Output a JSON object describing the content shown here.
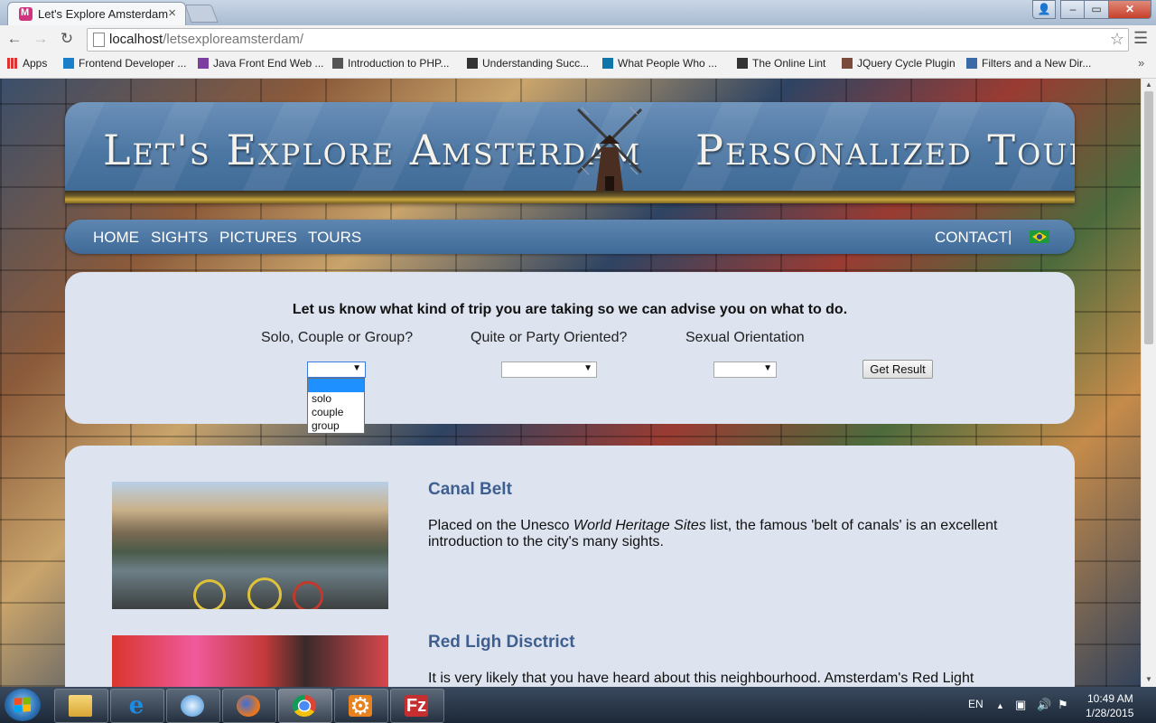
{
  "browser": {
    "tab_title": "Let's Explore Amsterdam",
    "url_host": "localhost",
    "url_path": "/letsexploreamsterdam/",
    "bookmarks": [
      {
        "label": "Apps",
        "icon": "apps-grid-icon",
        "color": "#d33"
      },
      {
        "label": "Frontend Developer ...",
        "icon": "bookmark-icon",
        "color": "#1a7fc8"
      },
      {
        "label": "Java Front End Web ...",
        "icon": "bookmark-icon",
        "color": "#7b3fa0"
      },
      {
        "label": "Introduction to PHP...",
        "icon": "bookmark-icon",
        "color": "#555"
      },
      {
        "label": "Understanding Succ...",
        "icon": "w3-icon",
        "color": "#333"
      },
      {
        "label": "What People Who ...",
        "icon": "linkedin-icon",
        "color": "#0e76a8"
      },
      {
        "label": "The Online Lint",
        "icon": "jsl-icon",
        "color": "#333"
      },
      {
        "label": "JQuery Cycle Plugin",
        "icon": "bookmark-icon",
        "color": "#7a4a3a"
      },
      {
        "label": "Filters and a New Dir...",
        "icon": "code-icon",
        "color": "#3a6aa8"
      }
    ]
  },
  "site": {
    "title": "Let's Explore Amsterdam",
    "subtitle": "Personalized Tours",
    "nav": [
      "HOME",
      "SIGHTS",
      "PICTURES",
      "TOURS"
    ],
    "contact": "CONTACT",
    "separator": "|"
  },
  "form": {
    "heading": "Let us know what kind of trip you are taking so we can advise you on what to do.",
    "questions": [
      "Solo, Couple or Group?",
      "Quite or Party Oriented?",
      "Sexual Orientation"
    ],
    "selected_values": [
      "",
      "",
      ""
    ],
    "open_dropdown_options": [
      "",
      "solo",
      "couple",
      "group"
    ],
    "button": "Get Result"
  },
  "sections": [
    {
      "title": "Canal Belt",
      "text_before": "Placed on the Unesco ",
      "text_em": "World Heritage Sites",
      "text_after": " list, the famous 'belt of canals' is an excellent introduction to the city's many sights."
    },
    {
      "title": "Red Ligh Disctrict",
      "text": "It is very likely that you have heard about this neighbourhood. Amsterdam's Red Light"
    }
  ],
  "taskbar": {
    "language": "EN",
    "time": "10:49 AM",
    "date": "1/28/2015",
    "apps": [
      "file-explorer-icon",
      "internet-explorer-icon",
      "safari-icon",
      "firefox-icon",
      "chrome-icon",
      "settings-gear-icon",
      "filezilla-icon"
    ]
  },
  "colors": {
    "accent_blue": "#4d77a3",
    "panel_bg": "#dde3ef",
    "section_title": "#3e5f8f"
  }
}
